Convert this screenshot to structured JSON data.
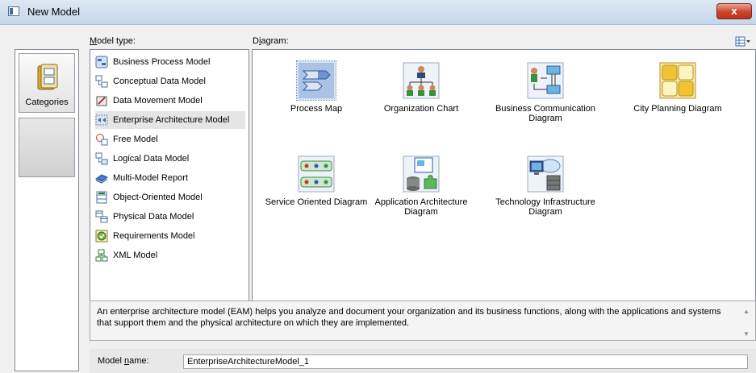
{
  "window": {
    "title": "New Model",
    "close_label": "x"
  },
  "categories": {
    "label": "Categories"
  },
  "model_type": {
    "label": "Model type:",
    "underline": "M",
    "rest": "odel type:"
  },
  "diagram": {
    "label": "Diagram:",
    "pre": "D",
    "underline": "i",
    "rest": "agram:"
  },
  "model_types": [
    {
      "label": "Business Process Model",
      "icon": "business-process-icon"
    },
    {
      "label": "Conceptual Data Model",
      "icon": "conceptual-data-icon"
    },
    {
      "label": "Data Movement Model",
      "icon": "data-movement-icon"
    },
    {
      "label": "Enterprise Architecture Model",
      "icon": "enterprise-architecture-icon",
      "selected": true
    },
    {
      "label": "Free Model",
      "icon": "free-model-icon"
    },
    {
      "label": "Logical Data Model",
      "icon": "logical-data-icon"
    },
    {
      "label": "Multi-Model Report",
      "icon": "multi-model-report-icon"
    },
    {
      "label": "Object-Oriented Model",
      "icon": "object-oriented-icon"
    },
    {
      "label": "Physical Data Model",
      "icon": "physical-data-icon"
    },
    {
      "label": "Requirements Model",
      "icon": "requirements-icon"
    },
    {
      "label": "XML Model",
      "icon": "xml-model-icon"
    }
  ],
  "diagrams": [
    {
      "label": "Process Map",
      "selected": true
    },
    {
      "label": "Organization Chart"
    },
    {
      "label": "Business Communication Diagram"
    },
    {
      "label": "City Planning Diagram"
    },
    {
      "label": "Service Oriented Diagram"
    },
    {
      "label": "Application Architecture Diagram"
    },
    {
      "label": "Technology Infrastructure Diagram"
    }
  ],
  "description": "An enterprise architecture model (EAM) helps you analyze and document your organization and its business functions, along with the applications and systems that support them and the physical architecture on which they are implemented.",
  "model_name": {
    "label_pre": "Model ",
    "label_u": "n",
    "label_rest": "ame:",
    "value": "EnterpriseArchitectureModel_1"
  }
}
